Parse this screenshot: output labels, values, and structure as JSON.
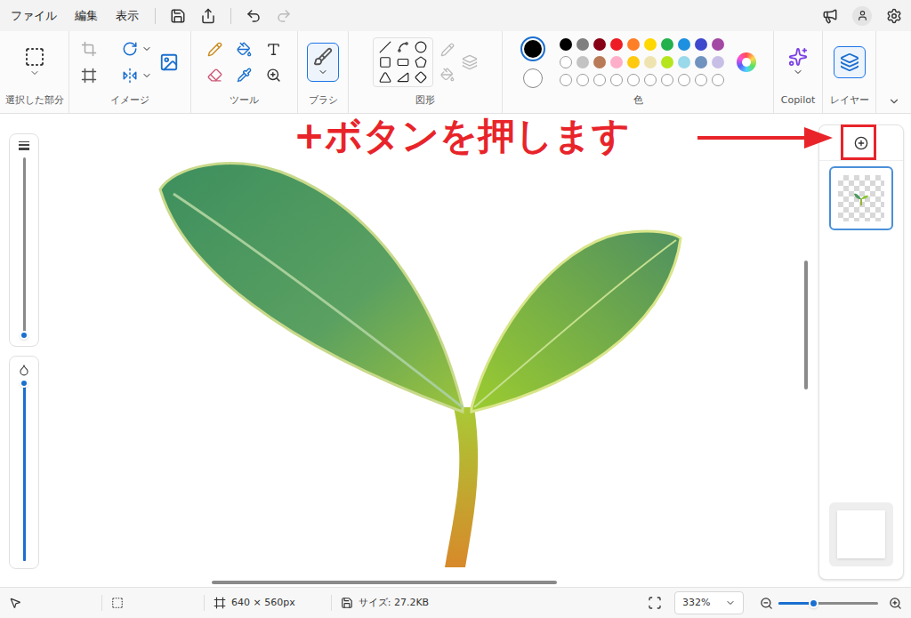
{
  "menu": [
    "ファイル",
    "編集",
    "表示"
  ],
  "ribbon_groups": [
    {
      "label": "選択した部分",
      "active": false
    },
    {
      "label": "イメージ",
      "active": false
    },
    {
      "label": "ツール",
      "active": false
    },
    {
      "label": "ブラシ",
      "active": true
    },
    {
      "label": "図形",
      "active": false
    },
    {
      "label": "色",
      "active": false
    },
    {
      "label": "Copilot",
      "active": false
    },
    {
      "label": "レイヤー",
      "active": true
    }
  ],
  "colors": {
    "primary": "#000000",
    "secondary": "#ffffff",
    "swatches": [
      {
        "kind": "filled",
        "color": "#000000"
      },
      {
        "kind": "filled",
        "color": "#7f7f7f"
      },
      {
        "kind": "filled",
        "color": "#880015"
      },
      {
        "kind": "filled",
        "color": "#ed1c24"
      },
      {
        "kind": "filled",
        "color": "#ff7f27"
      },
      {
        "kind": "filled",
        "color": "#ffd800"
      },
      {
        "kind": "filled",
        "color": "#22b14c"
      },
      {
        "kind": "filled",
        "color": "#1e90e0"
      },
      {
        "kind": "filled",
        "color": "#3f48cc"
      },
      {
        "kind": "filled",
        "color": "#a349a4"
      },
      {
        "kind": "empty",
        "color": "#ffffff"
      },
      {
        "kind": "filled",
        "color": "#c3c3c3"
      },
      {
        "kind": "filled",
        "color": "#b97a57"
      },
      {
        "kind": "filled",
        "color": "#ffaec9"
      },
      {
        "kind": "filled",
        "color": "#ffc90e"
      },
      {
        "kind": "filled",
        "color": "#efe4b0"
      },
      {
        "kind": "filled",
        "color": "#b5e61d"
      },
      {
        "kind": "filled",
        "color": "#99d9ea"
      },
      {
        "kind": "filled",
        "color": "#7092be"
      },
      {
        "kind": "filled",
        "color": "#c8bfe7"
      },
      {
        "kind": "empty",
        "color": "#ffffff"
      },
      {
        "kind": "empty",
        "color": "#ffffff"
      },
      {
        "kind": "empty",
        "color": "#ffffff"
      },
      {
        "kind": "empty",
        "color": "#ffffff"
      },
      {
        "kind": "empty",
        "color": "#ffffff"
      },
      {
        "kind": "empty",
        "color": "#ffffff"
      },
      {
        "kind": "empty",
        "color": "#ffffff"
      },
      {
        "kind": "empty",
        "color": "#ffffff"
      },
      {
        "kind": "empty",
        "color": "#ffffff"
      },
      {
        "kind": "empty",
        "color": "#ffffff"
      }
    ]
  },
  "sliders": [
    {
      "kind": "size",
      "level": 0.02
    },
    {
      "kind": "opacity",
      "level": 1
    }
  ],
  "layers": [
    {
      "kind": "transparent",
      "selected": true
    },
    {
      "kind": "solid",
      "selected": false
    }
  ],
  "annotation": {
    "text": "+ボタンを押します",
    "color": "#e8242a"
  },
  "status_bar": {
    "dimensions": "640 × 560px",
    "size": "サイズ: 27.2KB",
    "zoom": "332%",
    "zoom_level": 0.35
  }
}
